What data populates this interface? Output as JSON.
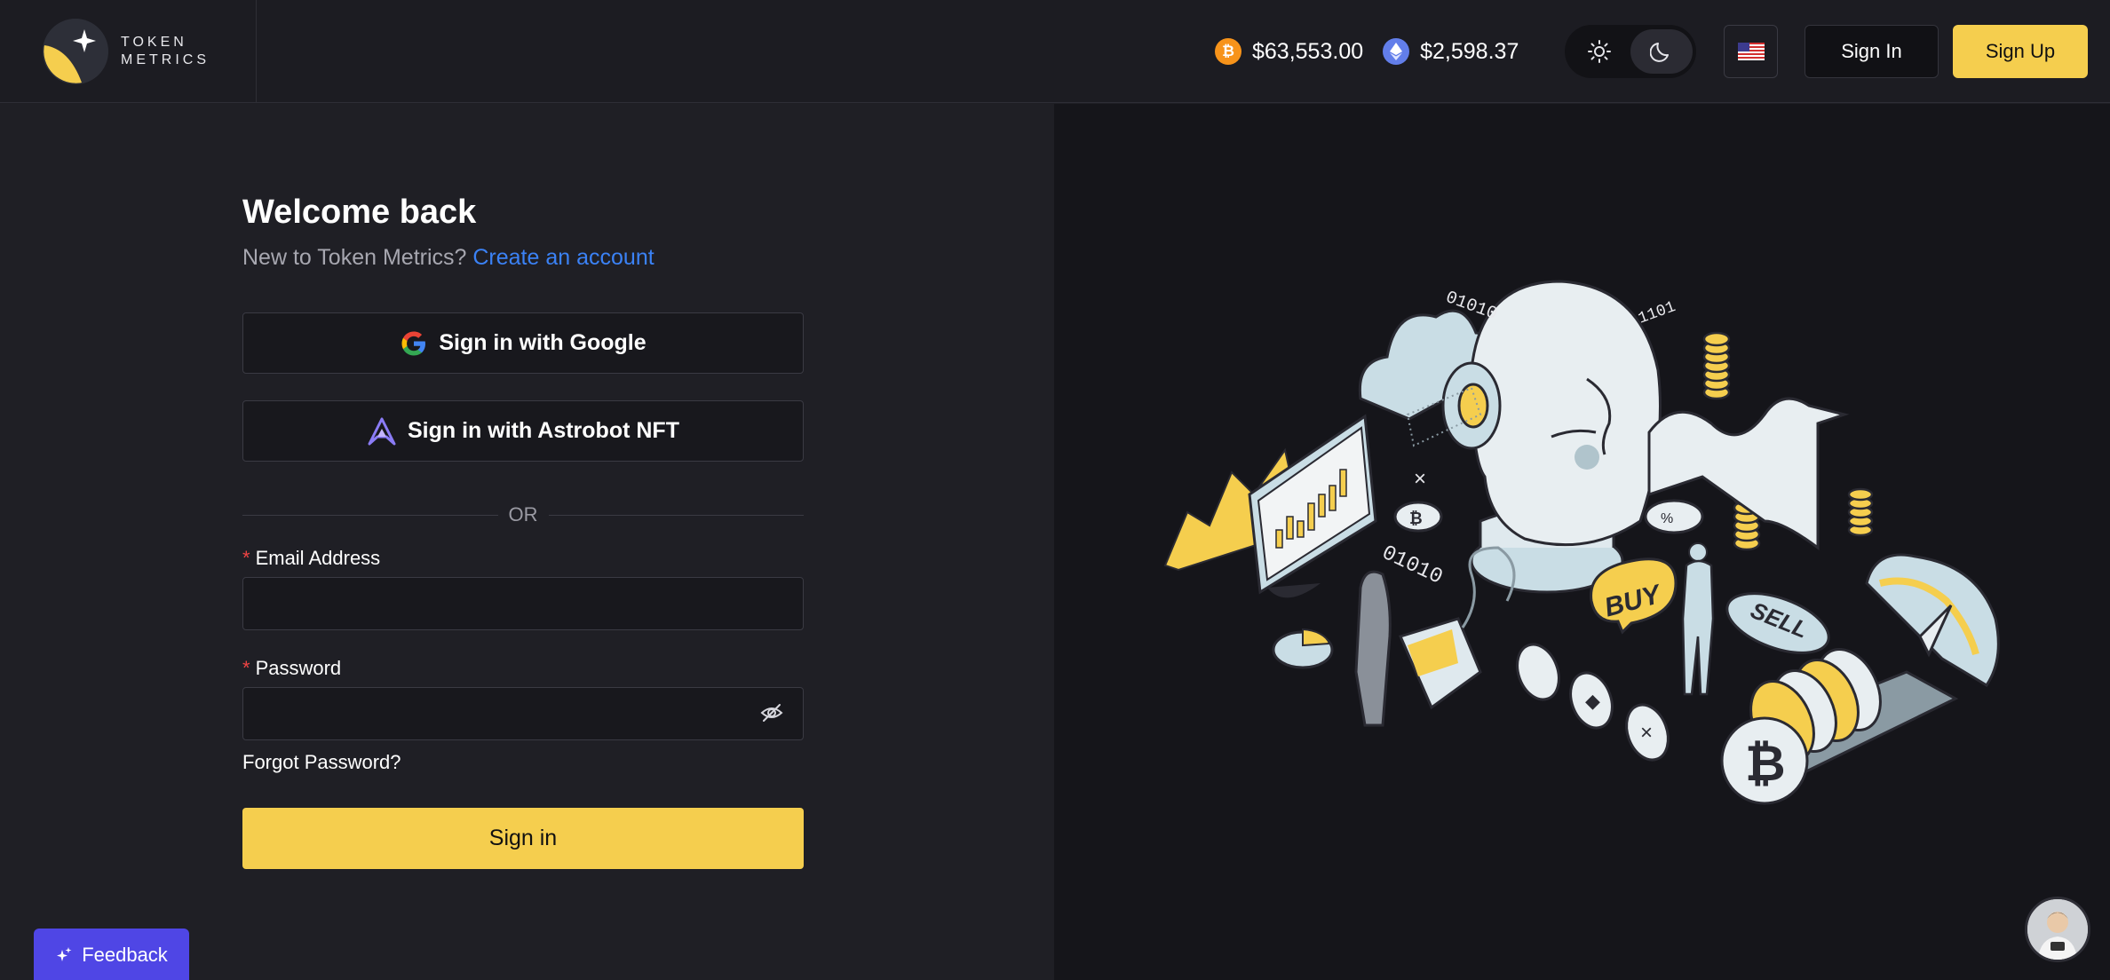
{
  "brand": {
    "line1": "TOKEN",
    "line2": "METRICS"
  },
  "prices": {
    "btc": {
      "icon": "bitcoin-icon",
      "symbol": "₿",
      "value": "$63,553.00"
    },
    "eth": {
      "icon": "ethereum-icon",
      "symbol": "◆",
      "value": "$2,598.37"
    }
  },
  "theme": {
    "selected": "dark"
  },
  "header": {
    "signin_label": "Sign In",
    "signup_label": "Sign Up"
  },
  "form": {
    "title": "Welcome back",
    "subtitle": "New to Token Metrics?",
    "create_link": "Create an account",
    "google_label": "Sign in with Google",
    "astrobot_label": "Sign in with Astrobot NFT",
    "or_text": "OR",
    "email_label": "Email Address",
    "email_value": "",
    "password_label": "Password",
    "password_value": "",
    "forgot_label": "Forgot Password?",
    "submit_label": "Sign in"
  },
  "illustration": {
    "buy": "BUY",
    "sell": "SELL",
    "binary1": "01010",
    "binary2": "01010",
    "binary3": "1101"
  },
  "feedback": {
    "label": "Feedback"
  },
  "colors": {
    "accent": "#f5ce4e",
    "link": "#3b82f6",
    "feedback": "#4f46e5",
    "background": "#1f1f25",
    "panel": "#15151a"
  }
}
